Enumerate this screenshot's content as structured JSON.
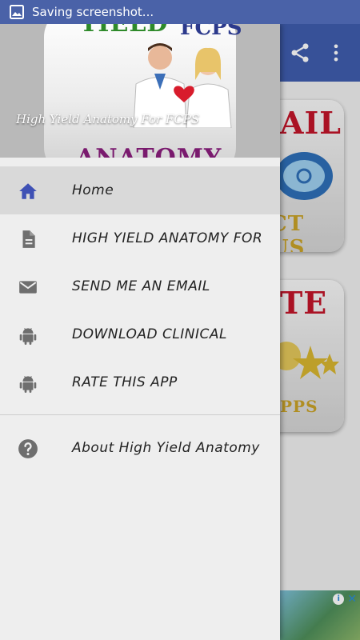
{
  "status_bar": {
    "text": "Saving screenshot...",
    "icon": "image-icon"
  },
  "drawer": {
    "header_title": "High Yield Anatomy For FCPS",
    "header_art": {
      "top_word": "YIELD",
      "top_word2": "FCPS",
      "bottom_word": "ANATOMY"
    },
    "items": [
      {
        "label": "Home",
        "icon": "home-icon",
        "active": true
      },
      {
        "label": "HIGH YIELD ANATOMY FOR",
        "icon": "document-icon",
        "active": false
      },
      {
        "label": "SEND ME AN EMAIL",
        "icon": "email-icon",
        "active": false
      },
      {
        "label": "DOWNLOAD CLINICAL",
        "icon": "android-icon",
        "active": false
      },
      {
        "label": "RATE THIS APP",
        "icon": "android-icon",
        "active": false
      }
    ],
    "secondary_items": [
      {
        "label": "About High Yield Anatomy",
        "icon": "help-icon"
      }
    ]
  },
  "background": {
    "tiles": [
      {
        "top_text": "AIL",
        "bottom_text": "CT US"
      },
      {
        "top_text": "TE",
        "bottom_text": "PPS"
      }
    ]
  },
  "colors": {
    "status_bar": "#4a62a8",
    "toolbar": "#3f5dad",
    "home_icon": "#3f51b5",
    "drawer_bg": "#eeeeee",
    "active_item": "#d9d9d9"
  }
}
